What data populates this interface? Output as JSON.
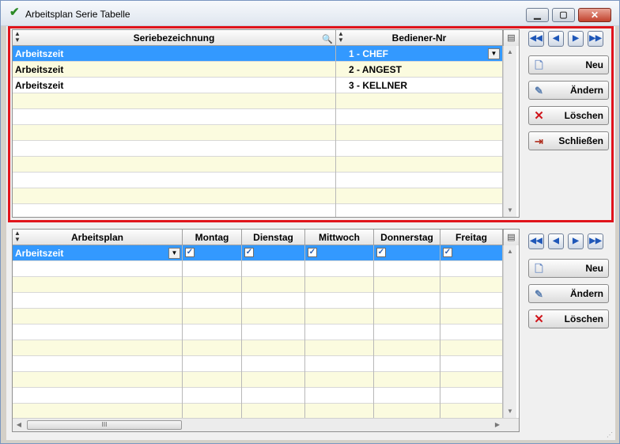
{
  "window": {
    "title": "Arbeitsplan Serie Tabelle",
    "title_icon": "check-icon",
    "controls": [
      "minimize-icon",
      "maximize-icon",
      "close-icon"
    ]
  },
  "top_grid": {
    "columns": [
      "Seriebezeichnung",
      "Bediener-Nr"
    ],
    "rows": [
      {
        "seriebezeichnung": "Arbeitszeit",
        "bediener": "1 - CHEF",
        "selected": true
      },
      {
        "seriebezeichnung": "Arbeitszeit",
        "bediener": "2 - ANGEST",
        "selected": false
      },
      {
        "seriebezeichnung": "Arbeitszeit",
        "bediener": "3 - KELLNER",
        "selected": false
      }
    ],
    "empty_rows": 8
  },
  "top_buttons": {
    "nav": [
      "first-icon",
      "prev-icon",
      "next-icon",
      "last-icon"
    ],
    "new": "Neu",
    "edit": "Ändern",
    "delete": "Löschen",
    "close": "Schließen"
  },
  "bottom_grid": {
    "columns": [
      "Arbeitsplan",
      "Montag",
      "Dienstag",
      "Mittwoch",
      "Donnerstag",
      "Freitag"
    ],
    "rows": [
      {
        "arbeitsplan": "Arbeitszeit",
        "montag": true,
        "dienstag": true,
        "mittwoch": true,
        "donnerstag": true,
        "freitag": true,
        "selected": true
      }
    ],
    "empty_rows": 10,
    "hscroll_thumb": "III"
  },
  "bottom_buttons": {
    "new": "Neu",
    "edit": "Ändern",
    "delete": "Löschen"
  },
  "colors": {
    "selection": "#3399ff",
    "row_alt": "#fbfbdf",
    "highlight_frame": "#e0141b"
  }
}
